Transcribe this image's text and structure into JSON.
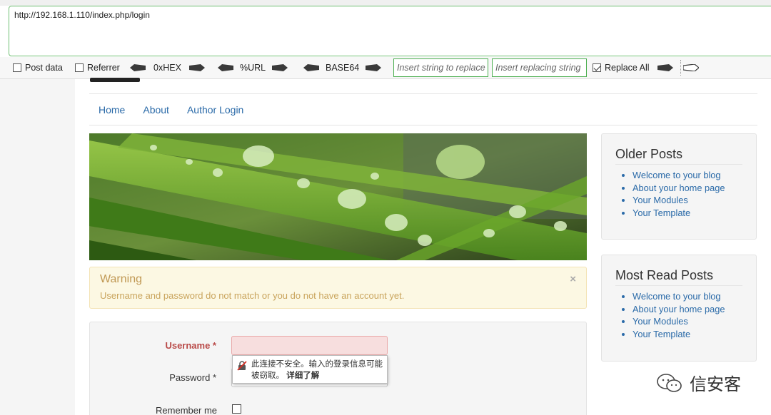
{
  "browser": {
    "url": "http://192.168.1.110/index.php/login"
  },
  "toolbar": {
    "post_data": "Post data",
    "referrer": "Referrer",
    "hex": "0xHEX",
    "url_encode": "%URL",
    "base64": "BASE64",
    "insert_placeholder": "Insert string to replace",
    "replacing_placeholder": "Insert replacing string",
    "replace_all": "Replace All"
  },
  "nav": {
    "items": [
      "Home",
      "About",
      "Author Login"
    ]
  },
  "warning": {
    "title": "Warning",
    "message": "Username and password do not match or you do not have an account yet.",
    "close": "×"
  },
  "form": {
    "username_label": "Username *",
    "password_label": "Password *",
    "remember_label": "Remember me",
    "tooltip_text": "此连接不安全。输入的登录信息可能被窃取。",
    "tooltip_link": "详细了解"
  },
  "sidebar": {
    "older_posts": {
      "title": "Older Posts",
      "items": [
        "Welcome to your blog",
        "About your home page",
        "Your Modules",
        "Your Template"
      ]
    },
    "most_read": {
      "title": "Most Read Posts",
      "items": [
        "Welcome to your blog",
        "About your home page",
        "Your Modules",
        "Your Template"
      ]
    }
  },
  "watermark": {
    "text": "信安客"
  },
  "colors": {
    "link": "#2a6aa8",
    "warning_bg": "#fcf8e3",
    "error_label": "#b94a48",
    "toolbar_green": "#4caf50"
  }
}
